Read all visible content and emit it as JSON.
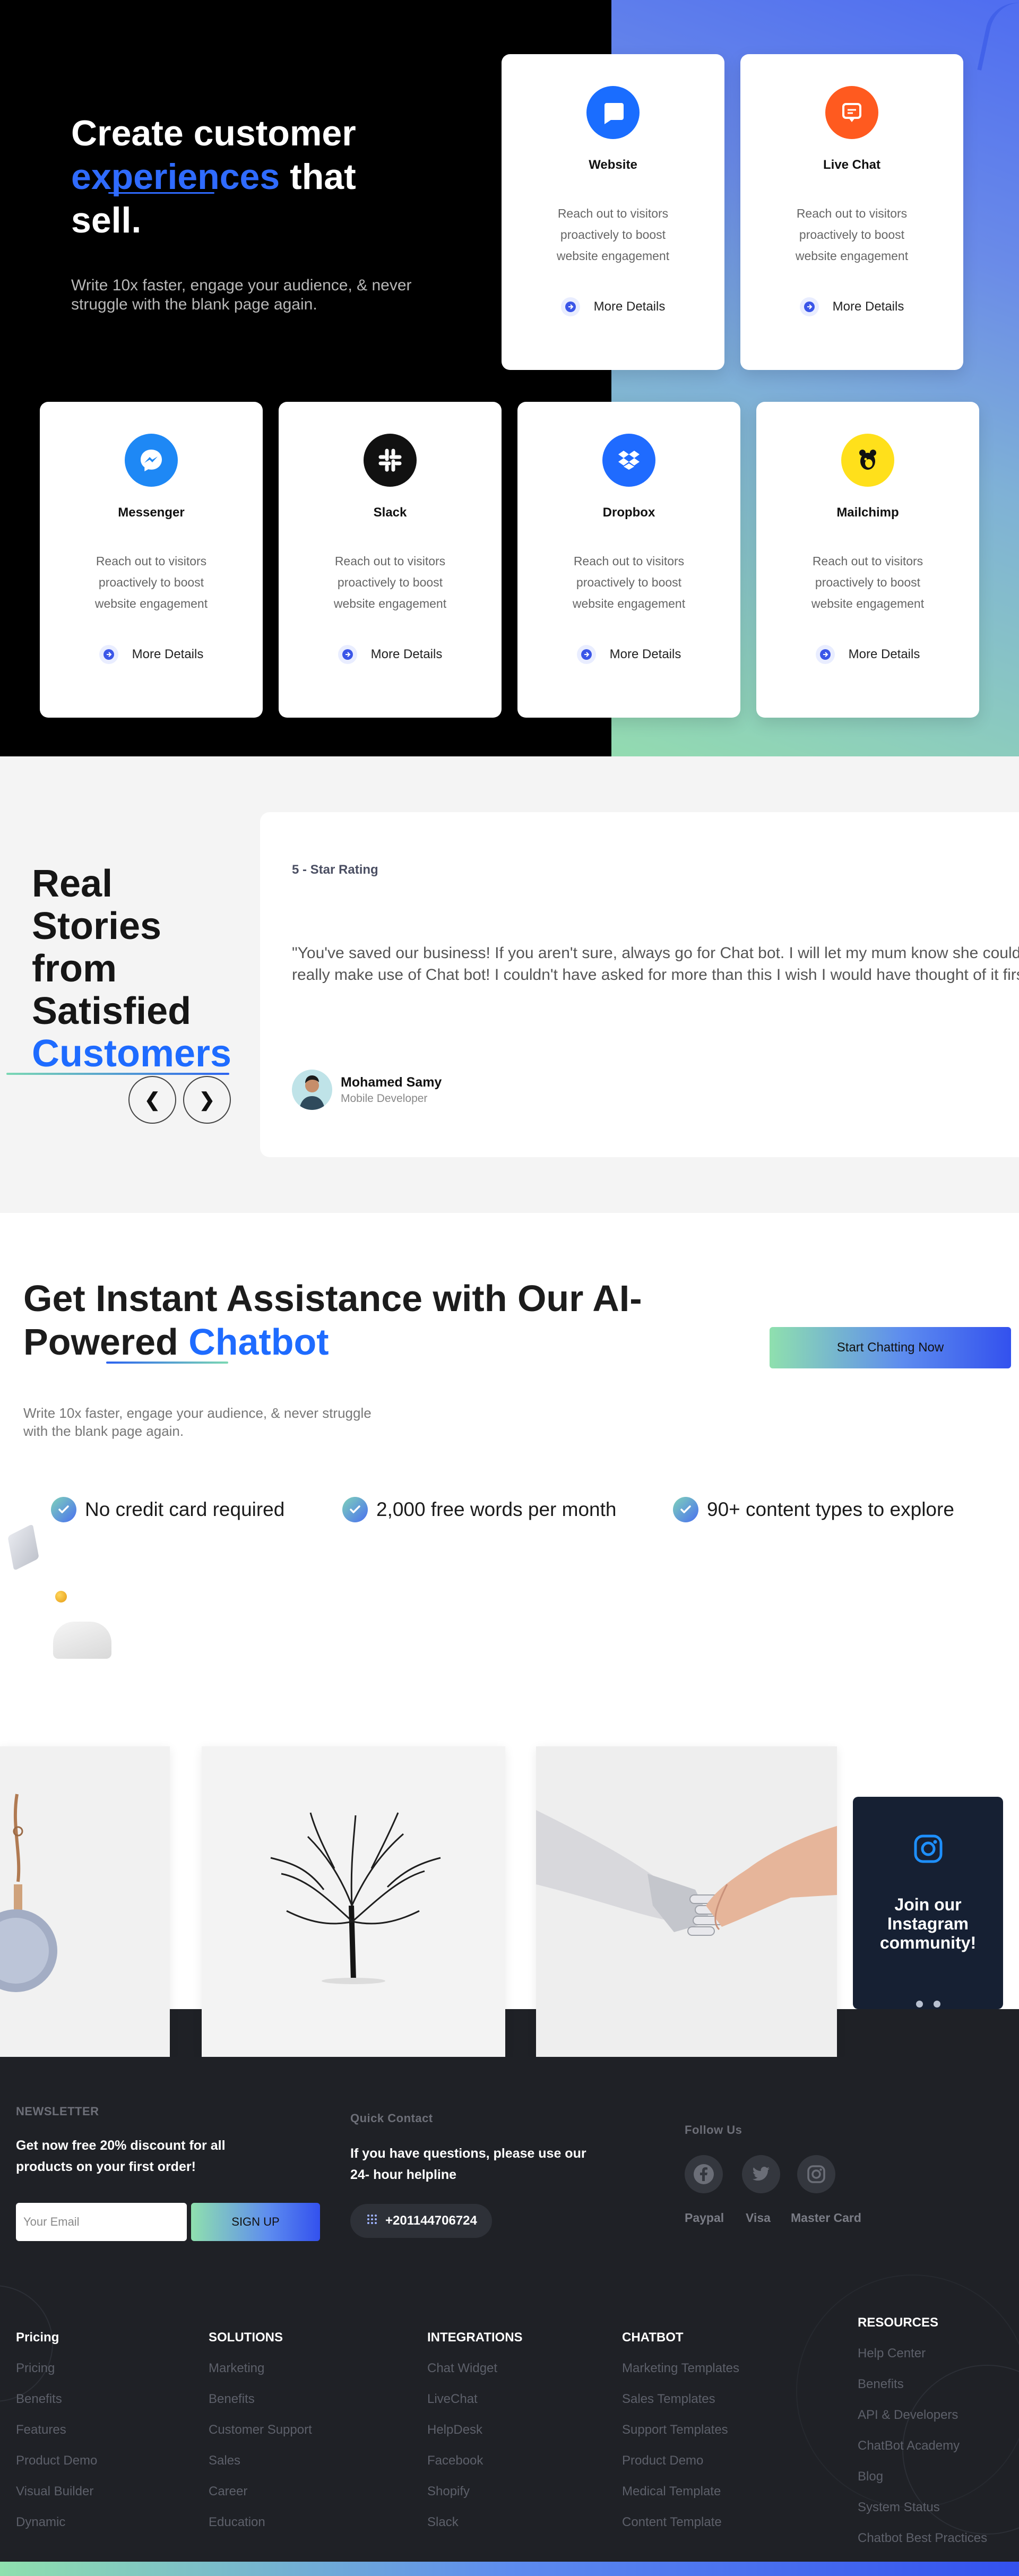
{
  "hero": {
    "title_line1": "Create customer",
    "title_hl": "experiences",
    "title_rest": " that",
    "title_line3": "sell.",
    "subtitle": "Write 10x faster, engage your audience, & never struggle with the blank page again."
  },
  "integrations": [
    {
      "name": "Website",
      "desc": "Reach out to visitors proactively to boost website engagement",
      "more": "More Details",
      "icon": "website-chat-icon",
      "color": "#1a6dff"
    },
    {
      "name": "Live Chat",
      "desc": "Reach out to visitors proactively to boost website engagement",
      "more": "More Details",
      "icon": "live-chat-icon",
      "color": "#ff5a1f"
    },
    {
      "name": "Messenger",
      "desc": "Reach out to visitors proactively to boost website engagement",
      "more": "More Details",
      "icon": "messenger-icon",
      "color": "#1e88f5"
    },
    {
      "name": "Slack",
      "desc": "Reach out to visitors proactively to boost website engagement",
      "more": "More Details",
      "icon": "slack-icon",
      "color": "#111111"
    },
    {
      "name": "Dropbox",
      "desc": "Reach out to visitors proactively to boost website engagement",
      "more": "More Details",
      "icon": "dropbox-icon",
      "color": "#1f6bff"
    },
    {
      "name": "Mailchimp",
      "desc": "Reach out to visitors proactively to boost website engagement",
      "more": "More Details",
      "icon": "mailchimp-icon",
      "color": "#ffe01b"
    }
  ],
  "testimonials": {
    "title": [
      "Real",
      "Stories",
      "from",
      "Satisfied"
    ],
    "title_hl": "Customers",
    "prev": "❮",
    "next": "❯",
    "rating": "5 - Star Rating",
    "quote": "\"You've saved our business! If you aren't sure, always go for Chat bot. I will let my mum know she could really make use of Chat bot! I couldn't have asked for more than this I wish I would have thought of it first. \"",
    "author_name": "Mohamed Samy",
    "author_role": "Mobile Developer"
  },
  "cta": {
    "title_line1": "Get Instant Assistance with Our AI-",
    "title_line2a": "Powered ",
    "title_line2b": "Chatbot",
    "button": "Start Chatting Now",
    "subtitle": "Write 10x faster, engage your audience, & never struggle with the blank page again.",
    "features": [
      "No credit card required",
      "2,000 free words per month",
      "90+ content types to explore"
    ]
  },
  "instagram": {
    "cta": "Join our Instagram community!"
  },
  "footer": {
    "newsletter_label": "NEWSLETTER",
    "newsletter_text": "Get now free 20% discount for all products on your first order!",
    "email_placeholder": "Your Email",
    "signup": "SIGN UP",
    "contact_label": "Quick Contact",
    "contact_text": "If you have questions, please use our 24- hour helpline",
    "phone": "+201144706724",
    "follow_label": "Follow Us",
    "payments": [
      "Paypal",
      "Visa",
      "Master Card"
    ],
    "columns": [
      {
        "title": "Pricing",
        "links": [
          "Pricing",
          "Benefits",
          "Features",
          "Product Demo",
          "Visual Builder",
          "Dynamic"
        ]
      },
      {
        "title": "SOLUTIONS",
        "links": [
          "Marketing",
          "Benefits",
          "Customer Support",
          "Sales",
          "Career",
          "Education"
        ]
      },
      {
        "title": "INTEGRATIONS",
        "links": [
          "Chat Widget",
          "LiveChat",
          "HelpDesk",
          "Facebook",
          "Shopify",
          "Slack"
        ]
      },
      {
        "title": "CHATBOT",
        "links": [
          "Marketing Templates",
          "Sales Templates",
          "Support Templates",
          "Product Demo",
          "Medical Template",
          "Content Template"
        ]
      },
      {
        "title": "RESOURCES",
        "links": [
          "Help Center",
          "Benefits",
          "API & Developers",
          "ChatBot Academy",
          "Blog",
          "System Status",
          "Chatbot Best Practices"
        ]
      }
    ]
  }
}
